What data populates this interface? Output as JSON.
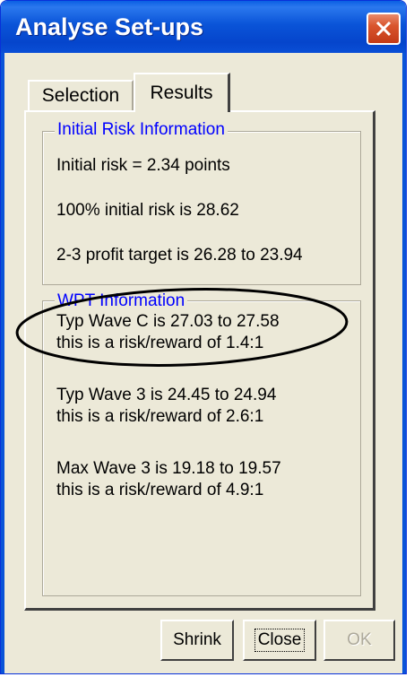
{
  "window": {
    "title": "Analyse Set-ups"
  },
  "tabs": [
    {
      "label": "Selection",
      "active": false
    },
    {
      "label": "Results",
      "active": true
    }
  ],
  "risk_group": {
    "legend": "Initial Risk Information",
    "lines": [
      "Initial risk = 2.34 points",
      "100% initial risk is 28.62",
      "2-3 profit target is 26.28 to 23.94"
    ]
  },
  "wpt_group": {
    "legend": "WPT Information",
    "items": [
      {
        "line1": "Typ Wave C is 27.03 to 27.58",
        "line2": "this is a risk/reward of 1.4:1"
      },
      {
        "line1": "Typ Wave 3 is 24.45 to 24.94",
        "line2": "this is a risk/reward of 2.6:1"
      },
      {
        "line1": "Max Wave 3 is 19.18 to 19.57",
        "line2": "this is a risk/reward of 4.9:1"
      }
    ]
  },
  "buttons": {
    "shrink": "Shrink",
    "close": "Close",
    "ok": "OK"
  },
  "colors": {
    "titlebar": "#0a54d8",
    "legend_text": "#0000ff",
    "window_bg": "#ece9d8"
  }
}
